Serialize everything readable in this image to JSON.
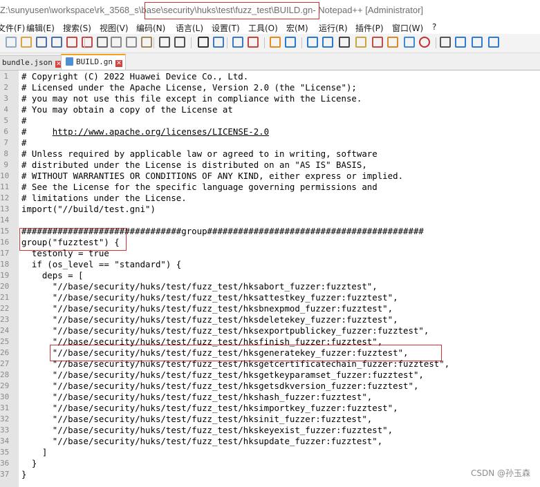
{
  "window": {
    "title_prefix": "Z:\\sunyusen\\workspace\\rk_3568_s\\",
    "title_highlight": "base\\security\\huks\\test\\fuzz_test\\BUILD.gn",
    "title_suffix": " - Notepad++ [Administrator]"
  },
  "menu": [
    "文件(F)",
    "编辑(E)",
    "搜索(S)",
    "视图(V)",
    "编码(N)",
    "语言(L)",
    "设置(T)",
    "工具(O)",
    "宏(M)",
    "运行(R)",
    "插件(P)",
    "窗口(W)",
    "?"
  ],
  "toolbar_icons": [
    "new-file-icon",
    "open-file-icon",
    "save-icon",
    "save-all-icon",
    "close-icon",
    "close-all-icon",
    "print-icon",
    "cut-icon",
    "copy-icon",
    "paste-icon",
    "undo-icon",
    "redo-icon",
    "find-icon",
    "replace-icon",
    "zoom-in-icon",
    "zoom-out-icon",
    "sync-vertical-icon",
    "sync-horizontal-icon",
    "word-wrap-icon",
    "show-all-chars-icon",
    "indent-guide-icon",
    "doc-map-icon",
    "function-list-icon",
    "folder-as-workspace-icon",
    "monitor-icon",
    "macro-record-icon",
    "macro-stop-icon",
    "macro-play-icon",
    "macro-run-multiple-icon",
    "macro-save-icon"
  ],
  "tabs": [
    {
      "label": "bundle.json",
      "active": false
    },
    {
      "label": "BUILD.gn",
      "active": true
    }
  ],
  "lines": [
    "# Copyright (C) 2022 Huawei Device Co., Ltd.",
    "# Licensed under the Apache License, Version 2.0 (the \"License\");",
    "# you may not use this file except in compliance with the License.",
    "# You may obtain a copy of the License at",
    "#",
    "#     http://www.apache.org/licenses/LICENSE-2.0",
    "#",
    "# Unless required by applicable law or agreed to in writing, software",
    "# distributed under the License is distributed on an \"AS IS\" BASIS,",
    "# WITHOUT WARRANTIES OR CONDITIONS OF ANY KIND, either express or implied.",
    "# See the License for the specific language governing permissions and",
    "# limitations under the License.",
    "import(\"//build/test.gni\")",
    "",
    "###############################group##########################################",
    "group(\"fuzztest\") {",
    "  testonly = true",
    "  if (os_level == \"standard\") {",
    "    deps = [",
    "      \"//base/security/huks/test/fuzz_test/hksabort_fuzzer:fuzztest\",",
    "      \"//base/security/huks/test/fuzz_test/hksattestkey_fuzzer:fuzztest\",",
    "      \"//base/security/huks/test/fuzz_test/hksbnexpmod_fuzzer:fuzztest\",",
    "      \"//base/security/huks/test/fuzz_test/hksdeletekey_fuzzer:fuzztest\",",
    "      \"//base/security/huks/test/fuzz_test/hksexportpublickey_fuzzer:fuzztest\",",
    "      \"//base/security/huks/test/fuzz_test/hksfinish_fuzzer:fuzztest\",",
    "      \"//base/security/huks/test/fuzz_test/hksgeneratekey_fuzzer:fuzztest\",",
    "      \"//base/security/huks/test/fuzz_test/hksgetcertificatechain_fuzzer:fuzztest\",",
    "      \"//base/security/huks/test/fuzz_test/hksgetkeyparamset_fuzzer:fuzztest\",",
    "      \"//base/security/huks/test/fuzz_test/hksgetsdkversion_fuzzer:fuzztest\",",
    "      \"//base/security/huks/test/fuzz_test/hkshash_fuzzer:fuzztest\",",
    "      \"//base/security/huks/test/fuzz_test/hksimportkey_fuzzer:fuzztest\",",
    "      \"//base/security/huks/test/fuzz_test/hksinit_fuzzer:fuzztest\",",
    "      \"//base/security/huks/test/fuzz_test/hkskeyexist_fuzzer:fuzztest\",",
    "      \"//base/security/huks/test/fuzz_test/hksupdate_fuzzer:fuzztest\",",
    "    ]",
    "  }",
    "}"
  ],
  "link_line": 6,
  "watermark": "CSDN @孙玉森"
}
